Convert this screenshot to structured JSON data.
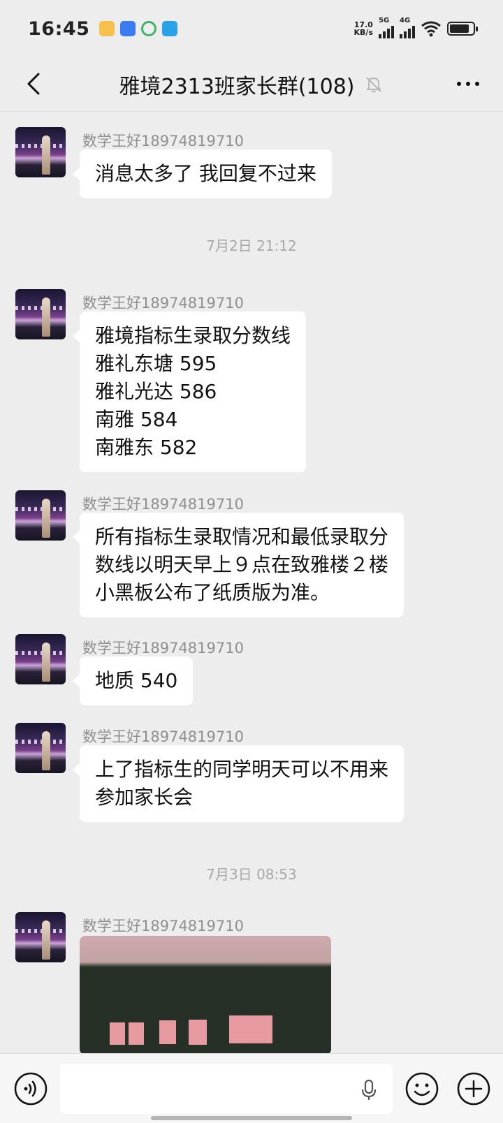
{
  "status_bar": {
    "time": "16:45",
    "net_speed_value": "17.0",
    "net_speed_unit": "KB/s",
    "signal_1_label": "5G",
    "signal_2_label": "4G",
    "battery_level": 0.85
  },
  "header": {
    "title": "雅境2313班家长群(108)"
  },
  "messages": [
    {
      "sender": "数学王好18974819710",
      "lines": [
        "消息太多了 我回复不过来"
      ]
    },
    {
      "sender": "数学王好18974819710",
      "lines": [
        "雅境指标生录取分数线",
        "雅礼东塘 595",
        "雅礼光达 586",
        "南雅 584",
        "南雅东 582"
      ]
    },
    {
      "sender": "数学王好18974819710",
      "lines": [
        "所有指标生录取情况和最低录取分",
        "数线以明天早上９点在致雅楼２楼",
        "小黑板公布了纸质版为准。"
      ]
    },
    {
      "sender": "数学王好18974819710",
      "lines": [
        "地质 540"
      ]
    },
    {
      "sender": "数学王好18974819710",
      "lines": [
        "上了指标生的同学明天可以不用来",
        "参加家长会"
      ]
    },
    {
      "sender": "数学王好18974819710"
    }
  ],
  "timestamps": [
    "7月2日 21:12",
    "7月3日 08:53"
  ],
  "input": {
    "value": ""
  },
  "colors": {
    "background": "#ededed",
    "bubble": "#ffffff",
    "sender_text": "#8f8f8f",
    "timestamp_text": "#a8a8a8"
  }
}
